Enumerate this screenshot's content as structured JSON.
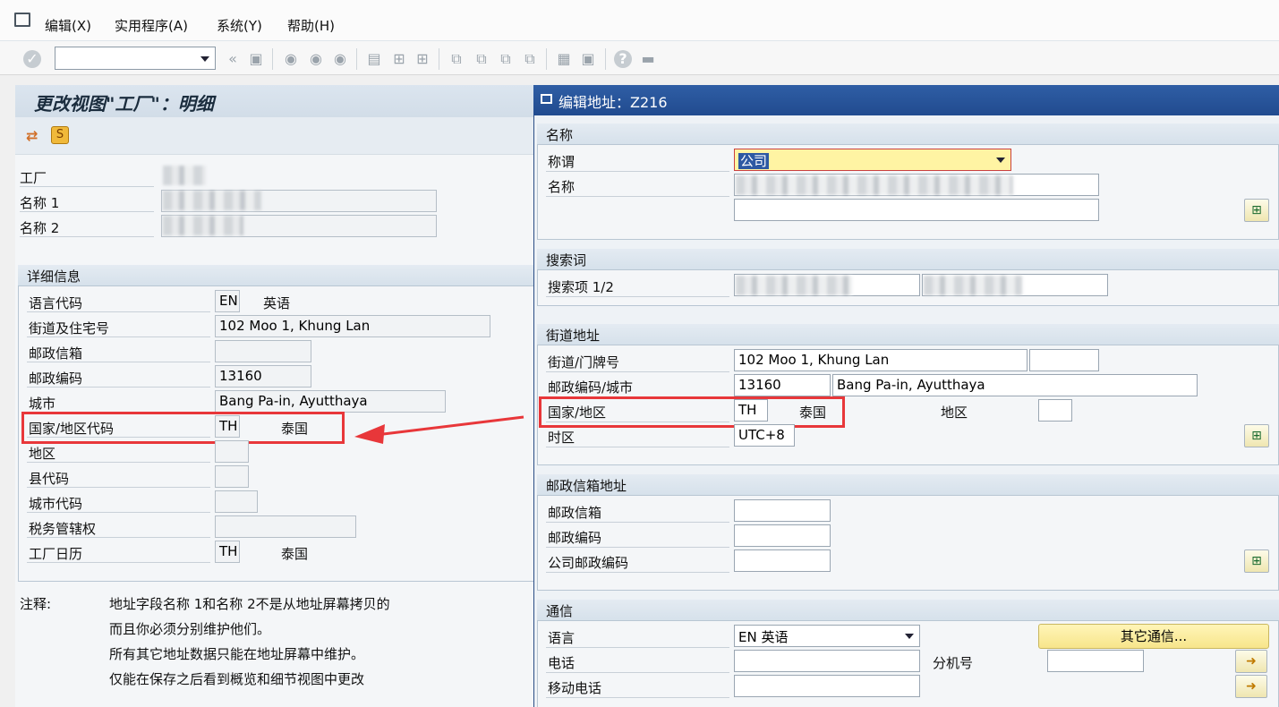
{
  "menu": {
    "window_icon": "window-menu-icon",
    "items": [
      "编辑(X)",
      "实用程序(A)",
      "系统(Y)",
      "帮助(H)"
    ]
  },
  "toolbar": {
    "command_value": "",
    "icons": [
      "enter-icon",
      "save-icon",
      "back-icon",
      "exit-icon",
      "cancel-icon",
      "print-icon",
      "find-icon",
      "find-next-icon",
      "first-page-icon",
      "previous-page-icon",
      "next-page-icon",
      "last-page-icon",
      "new-session-icon",
      "shortcut-icon",
      "help-icon",
      "customize-layout-icon"
    ]
  },
  "left": {
    "title": "更改视图\"工厂\"：明细",
    "app_icons": [
      "change-display-icon",
      "transport-icon"
    ],
    "header_fields": [
      {
        "label": "工厂",
        "value": ""
      },
      {
        "label": "名称 1",
        "value": ""
      },
      {
        "label": "名称 2",
        "value": ""
      }
    ],
    "details_title": "详细信息",
    "details": [
      {
        "label": "语言代码",
        "value": "EN",
        "text": "英语"
      },
      {
        "label": "街道及住宅号",
        "value": "102 Moo 1, Khung Lan",
        "text": ""
      },
      {
        "label": "邮政信箱",
        "value": "",
        "text": ""
      },
      {
        "label": "邮政编码",
        "value": "13160",
        "text": ""
      },
      {
        "label": "城市",
        "value": "Bang Pa-in, Ayutthaya",
        "text": ""
      },
      {
        "label": "国家/地区代码",
        "value": "TH",
        "text": "泰国"
      },
      {
        "label": "地区",
        "value": "",
        "text": ""
      },
      {
        "label": "县代码",
        "value": "",
        "text": ""
      },
      {
        "label": "城市代码",
        "value": "",
        "text": ""
      },
      {
        "label": "税务管辖权",
        "value": "",
        "text": ""
      },
      {
        "label": "工厂日历",
        "value": "TH",
        "text": "泰国"
      }
    ],
    "note_label": "注释:",
    "note_lines": [
      "地址字段名称 1和名称 2不是从地址屏幕拷贝的",
      "而且你必须分别维护他们。",
      "所有其它地址数据只能在地址屏幕中维护。",
      "仅能在保存之后看到概览和细节视图中更改"
    ]
  },
  "dialog": {
    "title": "编辑地址：Z216",
    "name_group": {
      "title": "名称",
      "salutation_label": "称谓",
      "salutation_value": "公司",
      "name_label": "名称"
    },
    "search_group": {
      "title": "搜索词",
      "label": "搜索项 1/2"
    },
    "street_group": {
      "title": "街道地址",
      "street_label": "街道/门牌号",
      "street_value": "102 Moo 1, Khung Lan",
      "postal_city_label": "邮政编码/城市",
      "postal_value": "13160",
      "city_value": "Bang Pa-in, Ayutthaya",
      "country_label": "国家/地区",
      "country_value": "TH",
      "country_text": "泰国",
      "region_label": "地区",
      "timezone_label": "时区",
      "timezone_value": "UTC+8"
    },
    "pobox_group": {
      "title": "邮政信箱地址",
      "pobox_label": "邮政信箱",
      "postal_label": "邮政编码",
      "company_postal_label": "公司邮政编码"
    },
    "comm_group": {
      "title": "通信",
      "language_label": "语言",
      "language_value": "EN 英语",
      "other_comm_label": "其它通信...",
      "phone_label": "电话",
      "ext_label": "分机号",
      "mobile_label": "移动电话"
    }
  },
  "colors": {
    "highlight": "#e8373a",
    "dialog_title_bg": "#2f5ea5",
    "selected_field": "#fff4a3"
  }
}
